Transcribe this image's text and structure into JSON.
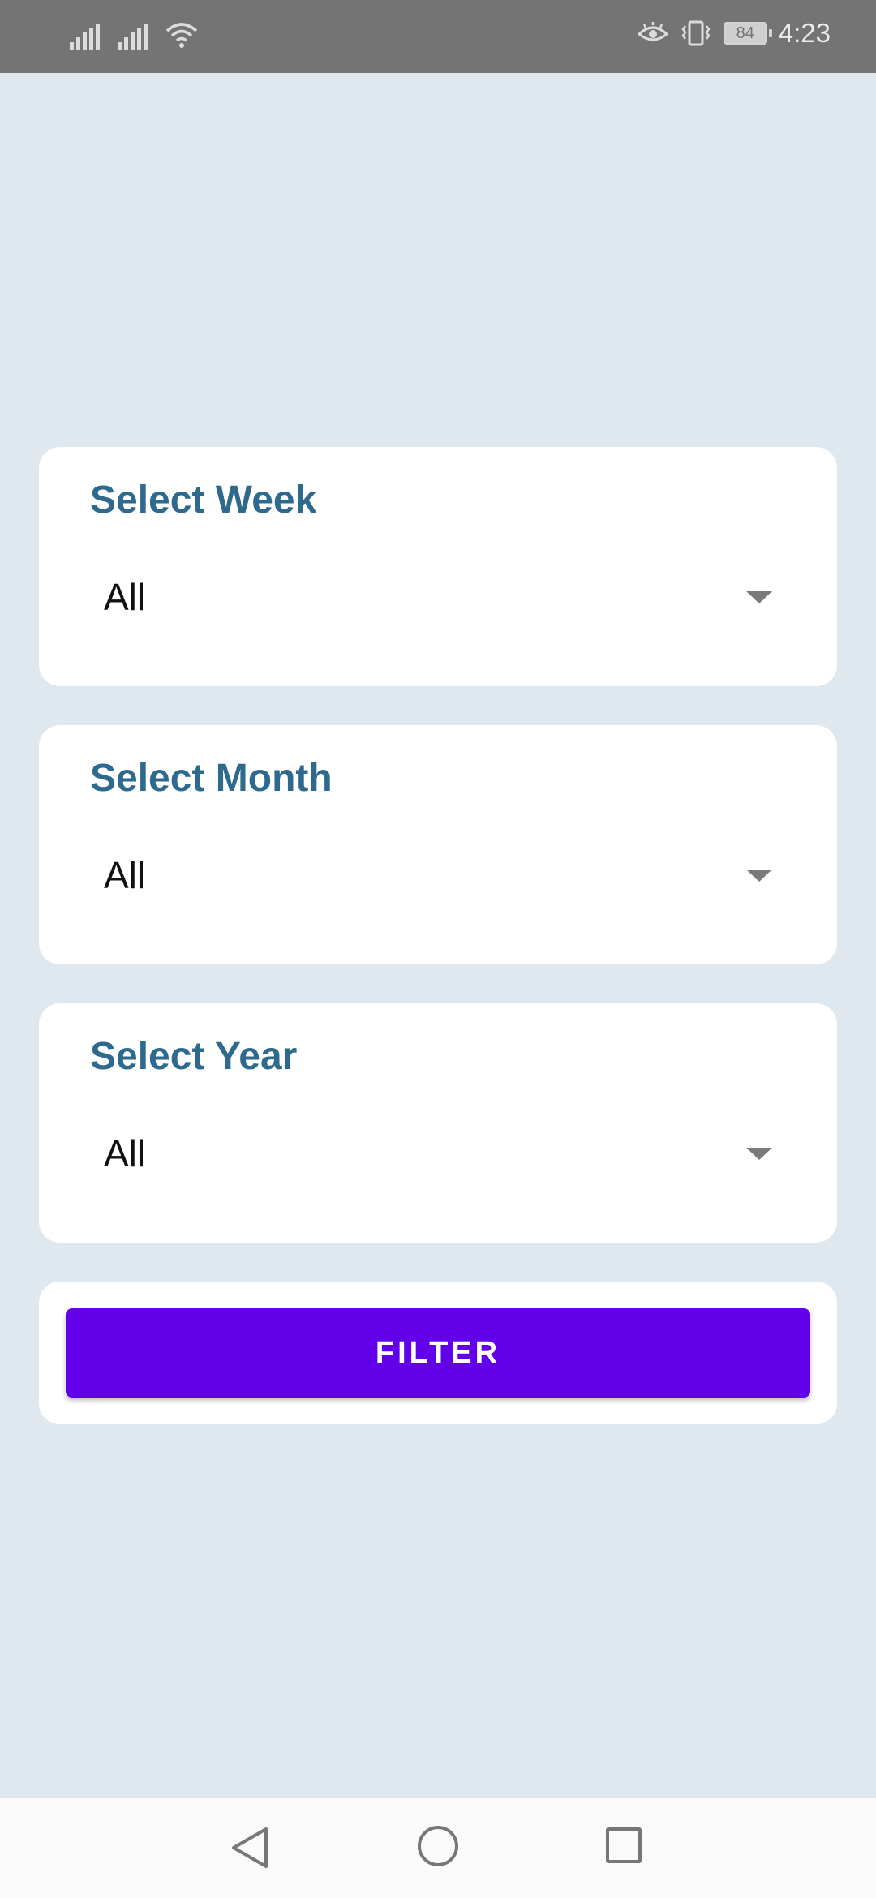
{
  "status_bar": {
    "battery_level": "84",
    "time": "4:23",
    "icons": [
      "signal-icon",
      "signal-icon",
      "wifi-icon",
      "eye-comfort-icon",
      "vibrate-icon",
      "battery-icon"
    ]
  },
  "filters": {
    "week": {
      "label": "Select Week",
      "value": "All"
    },
    "month": {
      "label": "Select Month",
      "value": "All"
    },
    "year": {
      "label": "Select Year",
      "value": "All"
    }
  },
  "filter_button": {
    "label": "FILTER",
    "color": "#6200ea"
  },
  "colors": {
    "background": "#dee8ee",
    "card_title": "#2e6a8e",
    "card": "#ffffff"
  },
  "nav_bar": {
    "icons": [
      "back-icon",
      "home-icon",
      "recent-apps-icon"
    ]
  }
}
